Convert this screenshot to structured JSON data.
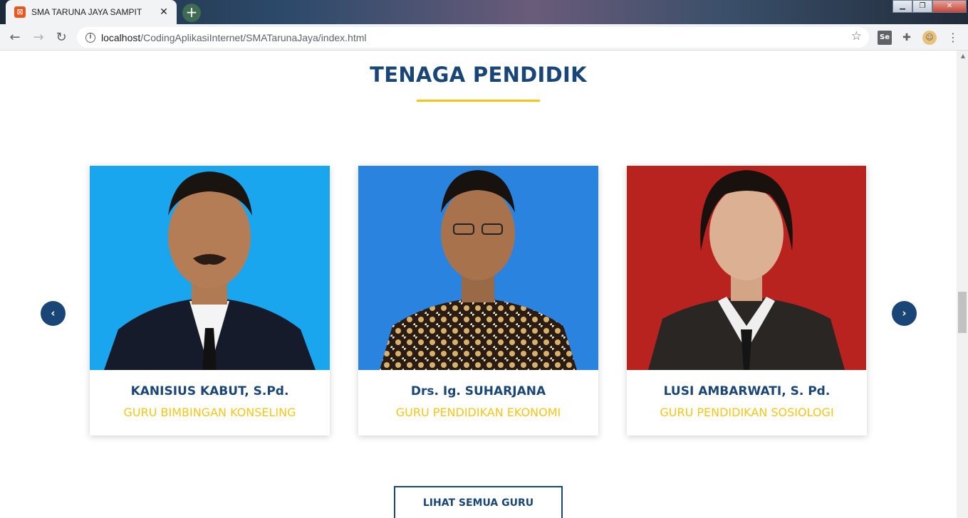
{
  "browser": {
    "tab_title": "SMA TARUNA JAYA SAMPIT",
    "url_host": "localhost",
    "url_path": "/CodingAplikasiInternet/SMATarunaJaya/index.html",
    "tab_close_glyph": "✕",
    "new_tab_glyph": "+",
    "nav": {
      "back": "←",
      "forward": "→",
      "reload": "↻"
    },
    "extensions": {
      "se_label": "Se",
      "menu_glyph": "⋮"
    }
  },
  "section": {
    "title": "TENAGA PENDIDIK",
    "underline_color": "#f5c518"
  },
  "teachers": [
    {
      "name": "KANISIUS KABUT, S.Pd.",
      "role": "GURU BIMBINGAN KONSELING",
      "photo_background": "#1aa6ee"
    },
    {
      "name": "Drs. Ig. SUHARJANA",
      "role": "GURU PENDIDIKAN EKONOMI",
      "photo_background": "#2b83e0"
    },
    {
      "name": "LUSI AMBARWATI, S. Pd.",
      "role": "GURU PENDIDIKAN SOSIOLOGI",
      "photo_background": "#b8231f"
    }
  ],
  "carousel": {
    "prev_glyph": "‹",
    "next_glyph": "›"
  },
  "cta": {
    "see_all_label": "LIHAT SEMUA GURU"
  },
  "colors": {
    "primary": "#1a4677",
    "accent": "#f5c518"
  }
}
